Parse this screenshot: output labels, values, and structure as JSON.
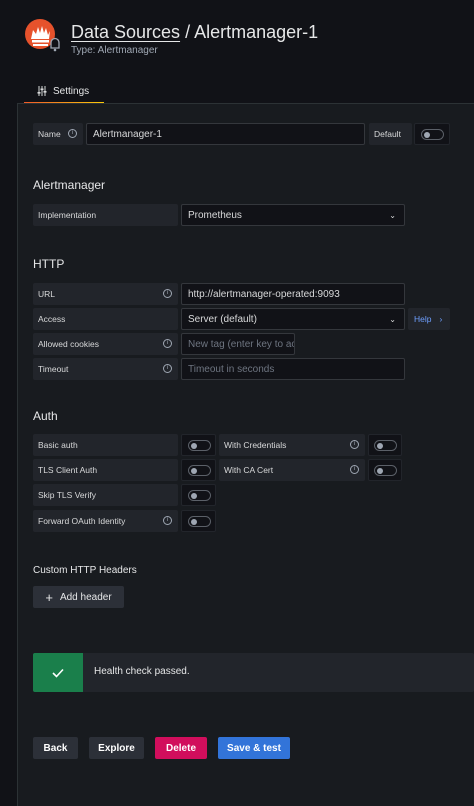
{
  "header": {
    "breadcrumb_parent": "Data Sources",
    "separator": " / ",
    "title": "Alertmanager-1",
    "subtitle": "Type: Alertmanager",
    "logo_icon": "alertmanager-logo",
    "tab_label": "Settings",
    "tab_icon": "sliders-icon"
  },
  "general": {
    "name_label": "Name",
    "name_value": "Alertmanager-1",
    "default_label": "Default",
    "default_enabled": false
  },
  "alertmanager": {
    "section_title": "Alertmanager",
    "implementation_label": "Implementation",
    "implementation_value": "Prometheus"
  },
  "http": {
    "section_title": "HTTP",
    "url_label": "URL",
    "url_value": "http://alertmanager-operated:9093",
    "access_label": "Access",
    "access_value": "Server (default)",
    "help_label": "Help",
    "cookies_label": "Allowed cookies",
    "cookies_placeholder": "New tag (enter key to ac",
    "timeout_label": "Timeout",
    "timeout_placeholder": "Timeout in seconds"
  },
  "auth": {
    "section_title": "Auth",
    "basic_auth_label": "Basic auth",
    "with_credentials_label": "With Credentials",
    "tls_client_auth_label": "TLS Client Auth",
    "with_ca_cert_label": "With CA Cert",
    "skip_tls_label": "Skip TLS Verify",
    "forward_oauth_label": "Forward OAuth Identity",
    "toggles": {
      "basic_auth": false,
      "with_credentials": false,
      "tls_client_auth": false,
      "with_ca_cert": false,
      "skip_tls": false,
      "forward_oauth": false
    }
  },
  "headers": {
    "section_title": "Custom HTTP Headers",
    "add_label": "Add header"
  },
  "health": {
    "message": "Health check passed.",
    "icon": "check-icon",
    "color": "#1a7f4b"
  },
  "actions": {
    "back_label": "Back",
    "explore_label": "Explore",
    "delete_label": "Delete",
    "save_label": "Save & test",
    "delete_color": "#d10e5c",
    "save_color": "#3274d9"
  }
}
